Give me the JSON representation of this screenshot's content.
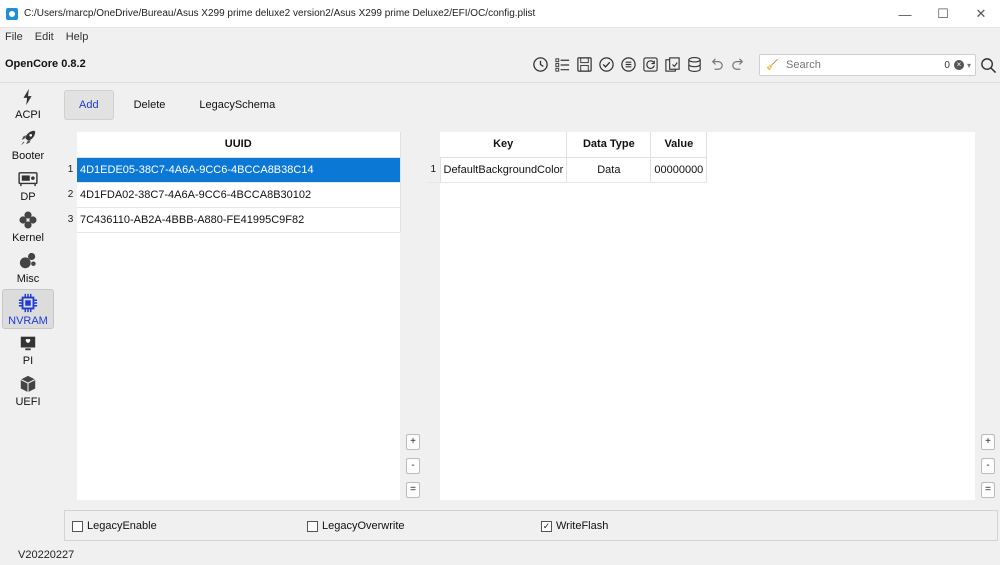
{
  "window": {
    "title": "C:/Users/marcp/OneDrive/Bureau/Asus X299 prime deluxe2 version2/Asus X299 prime Deluxe2/EFI/OC/config.plist",
    "minimize": "—",
    "maximize": "☐",
    "close": "✕"
  },
  "menu": [
    "File",
    "Edit",
    "Help"
  ],
  "brand": "OpenCore 0.8.2",
  "toolbar_icons": [
    "clock-icon",
    "list-icon",
    "save-icon",
    "check-circle-icon",
    "list-circle-icon",
    "refresh-icon",
    "export-icon",
    "database-icon",
    "undo-icon",
    "redo-icon"
  ],
  "search": {
    "placeholder": "Search",
    "count": "0"
  },
  "sidebar": [
    {
      "label": "ACPI",
      "icon": "bolt-icon"
    },
    {
      "label": "Booter",
      "icon": "rocket-icon"
    },
    {
      "label": "DP",
      "icon": "gpu-icon"
    },
    {
      "label": "Kernel",
      "icon": "kernel-icon"
    },
    {
      "label": "Misc",
      "icon": "misc-icon"
    },
    {
      "label": "NVRAM",
      "icon": "chip-icon"
    },
    {
      "label": "PI",
      "icon": "platform-icon"
    },
    {
      "label": "UEFI",
      "icon": "cube-icon"
    }
  ],
  "tabs": [
    "Add",
    "Delete",
    "LegacySchema"
  ],
  "uuid_table": {
    "header": "UUID",
    "rows": [
      {
        "n": "1",
        "v": "4D1EDE05-38C7-4A6A-9CC6-4BCCA8B38C14"
      },
      {
        "n": "2",
        "v": "4D1FDA02-38C7-4A6A-9CC6-4BCCA8B30102"
      },
      {
        "n": "3",
        "v": "7C436110-AB2A-4BBB-A880-FE41995C9F82"
      }
    ]
  },
  "kv_table": {
    "headers": [
      "Key",
      "Data Type",
      "Value"
    ],
    "rows": [
      {
        "n": "1",
        "key": "DefaultBackgroundColor",
        "type": "Data",
        "value": "00000000"
      }
    ]
  },
  "mini_buttons": [
    "+",
    "-",
    "="
  ],
  "options": [
    {
      "label": "LegacyEnable",
      "checked": false
    },
    {
      "label": "LegacyOverwrite",
      "checked": false
    },
    {
      "label": "WriteFlash",
      "checked": true
    }
  ],
  "check_mark": "✓",
  "version": "V20220227"
}
